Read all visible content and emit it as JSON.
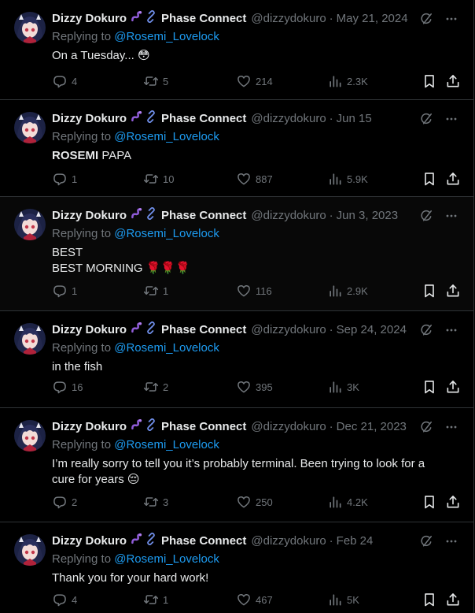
{
  "colors": {
    "background": "#000000",
    "text": "#e7e9ea",
    "muted": "#71767b",
    "link": "#1d9bf0",
    "divider": "#2f3336"
  },
  "icons": {
    "name_emoji_1": "worm-emoji",
    "name_emoji_2": "link-emoji",
    "top_1": "grok-icon",
    "top_2": "more-icon",
    "actions": [
      "reply-icon",
      "retweet-icon",
      "like-icon",
      "views-icon",
      "bookmark-icon",
      "share-icon"
    ]
  },
  "tweets": [
    {
      "name": "Dizzy Dokuro",
      "org": "Phase Connect",
      "handle": "@dizzydokuro",
      "sep": "·",
      "date": "May 21, 2024",
      "replying_prefix": "Replying to ",
      "replying_to": "@Rosemi_Lovelock",
      "lines": [
        {
          "bold": "",
          "text": "On a Tuesday... 😳"
        }
      ],
      "replies": "4",
      "retweets": "5",
      "likes": "214",
      "views": "2.3K"
    },
    {
      "name": "Dizzy Dokuro",
      "org": "Phase Connect",
      "handle": "@dizzydokuro",
      "sep": "·",
      "date": "Jun 15",
      "replying_prefix": "Replying to ",
      "replying_to": "@Rosemi_Lovelock",
      "lines": [
        {
          "bold": "ROSEMI",
          "text": " PAPA"
        }
      ],
      "replies": "1",
      "retweets": "10",
      "likes": "887",
      "views": "5.9K"
    },
    {
      "name": "Dizzy Dokuro",
      "org": "Phase Connect",
      "handle": "@dizzydokuro",
      "sep": "·",
      "date": "Jun 3, 2023",
      "replying_prefix": "Replying to ",
      "replying_to": "@Rosemi_Lovelock",
      "lines": [
        {
          "bold": "",
          "text": "BEST"
        },
        {
          "bold": "",
          "text": "BEST MORNING 🌹🌹🌹"
        }
      ],
      "replies": "1",
      "retweets": "1",
      "likes": "116",
      "views": "2.9K"
    },
    {
      "name": "Dizzy Dokuro",
      "org": "Phase Connect",
      "handle": "@dizzydokuro",
      "sep": "·",
      "date": "Sep 24, 2024",
      "replying_prefix": "Replying to ",
      "replying_to": "@Rosemi_Lovelock",
      "lines": [
        {
          "bold": "",
          "text": "in the fish"
        }
      ],
      "replies": "16",
      "retweets": "2",
      "likes": "395",
      "views": "3K"
    },
    {
      "name": "Dizzy Dokuro",
      "org": "Phase Connect",
      "handle": "@dizzydokuro",
      "sep": "·",
      "date": "Dec 21, 2023",
      "replying_prefix": "Replying to ",
      "replying_to": "@Rosemi_Lovelock",
      "lines": [
        {
          "bold": "",
          "text": "I’m really sorry to tell you it’s probably terminal. Been trying to look for a"
        },
        {
          "bold": "",
          "text": "cure for years 😔"
        }
      ],
      "replies": "2",
      "retweets": "3",
      "likes": "250",
      "views": "4.2K"
    },
    {
      "name": "Dizzy Dokuro",
      "org": "Phase Connect",
      "handle": "@dizzydokuro",
      "sep": "·",
      "date": "Feb 24",
      "replying_prefix": "Replying to ",
      "replying_to": "@Rosemi_Lovelock",
      "lines": [
        {
          "bold": "",
          "text": "Thank you for your hard work!"
        }
      ],
      "replies": "4",
      "retweets": "1",
      "likes": "467",
      "views": "5K"
    }
  ]
}
